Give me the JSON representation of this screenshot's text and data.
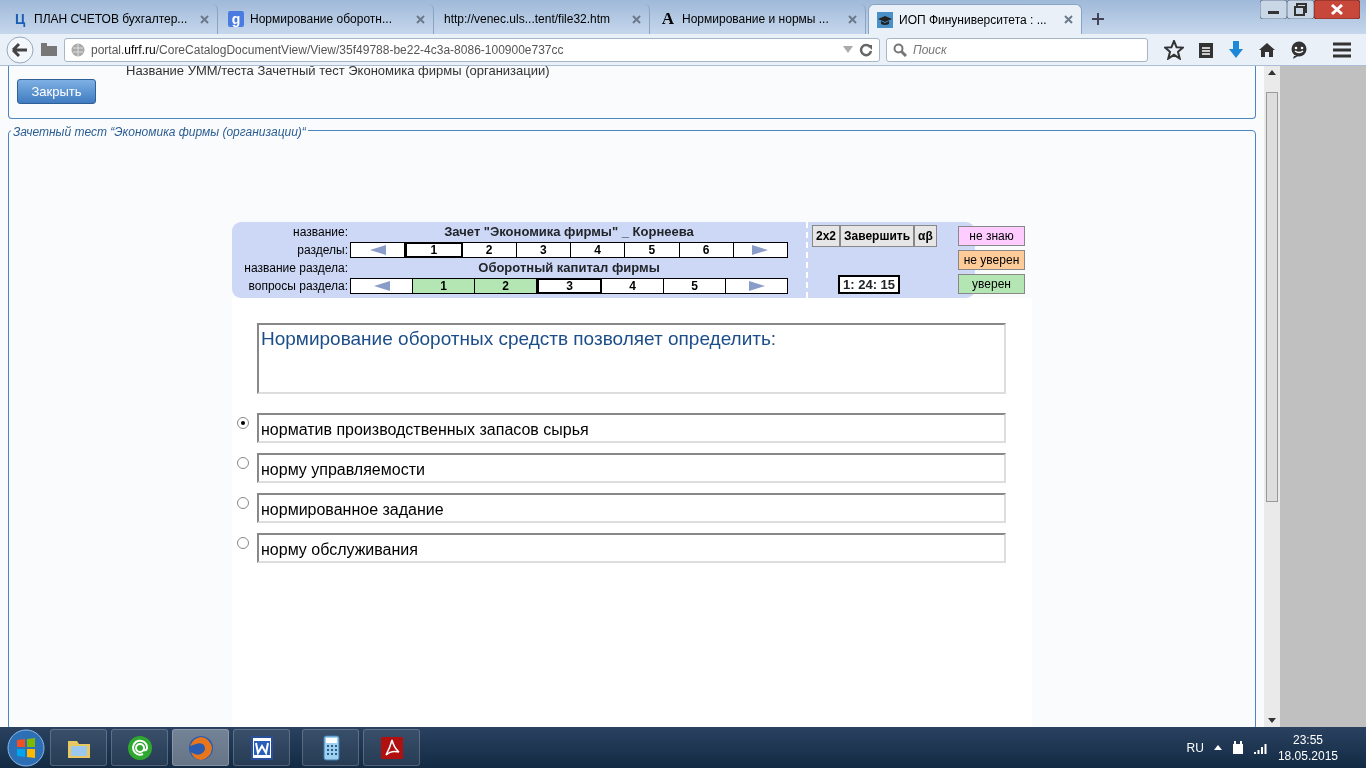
{
  "browser": {
    "tabs": [
      {
        "kind": "letter",
        "icon_text": "Ц",
        "title": "ПЛАН СЧЕТОВ бухгалтер...",
        "selected": false
      },
      {
        "kind": "google",
        "icon_text": "g",
        "title": "Нормирование оборотн...",
        "selected": false
      },
      {
        "kind": "plain",
        "title": "http://venec.uls...tent/file32.htm",
        "selected": false
      },
      {
        "kind": "serif",
        "icon_text": "A",
        "title": "Нормирование и нормы ...",
        "selected": false
      },
      {
        "kind": "cap",
        "title": "ИОП Финуниверситета : ...",
        "selected": true
      }
    ],
    "url": "portal.**ufrf.ru**/CoreCatalogDocumentView/View/35f49788-be22-4c3a-8086-100900e737cc",
    "search": {
      "placeholder": "Поиск"
    }
  },
  "page": {
    "header_text": "Название УММ/теста  Зачетный тест  Экономика фирмы (организации)",
    "close_button": "Закрыть",
    "legend": "Зачетный тест “Экономика фирмы (организации)“",
    "test": {
      "name_label": "название:",
      "name": "Зачет \"Экономика фирмы\" _ Корнеева",
      "sections_label": "разделы:",
      "sections": [
        {
          "label": "1",
          "selected": true
        },
        {
          "label": "2",
          "selected": false
        },
        {
          "label": "3",
          "selected": false
        },
        {
          "label": "4",
          "selected": false
        },
        {
          "label": "5",
          "selected": false
        },
        {
          "label": "6",
          "selected": false
        }
      ],
      "section_name_label": "название раздела:",
      "section_name": "Оборотный капитал фирмы",
      "questions_label": "вопросы раздела:",
      "questions": [
        {
          "label": "1",
          "answered": true,
          "selected": false
        },
        {
          "label": "2",
          "answered": true,
          "selected": false
        },
        {
          "label": "3",
          "answered": false,
          "selected": true
        },
        {
          "label": "4",
          "answered": false,
          "selected": false
        },
        {
          "label": "5",
          "answered": false,
          "selected": false
        }
      ],
      "buttons": [
        "2x2",
        "Завершить",
        "αβ"
      ],
      "timer": "1: 24: 15",
      "confidence": [
        {
          "label": "не знаю",
          "color": "#ffccff"
        },
        {
          "label": "не уверен",
          "color": "#ffcc99"
        },
        {
          "label": "уверен",
          "color": "#b3e6b3"
        }
      ]
    },
    "question": "Нормирование оборотных средств позволяет определить:",
    "options": [
      {
        "text": "норматив производственных запасов сырья",
        "selected": true
      },
      {
        "text": "норму управляемости",
        "selected": false
      },
      {
        "text": "нормированное задание",
        "selected": false
      },
      {
        "text": "норму обслуживания",
        "selected": false
      }
    ]
  },
  "taskbar": {
    "apps": [
      {
        "kind": "folder",
        "active": false
      },
      {
        "kind": "mail",
        "active": false
      },
      {
        "kind": "firefox",
        "active": true
      },
      {
        "kind": "word",
        "active": false
      },
      {
        "kind": "calculator",
        "active": false
      },
      {
        "kind": "pdf",
        "active": false
      }
    ],
    "language": "RU",
    "time": "23:55",
    "date": "18.05.2015"
  }
}
